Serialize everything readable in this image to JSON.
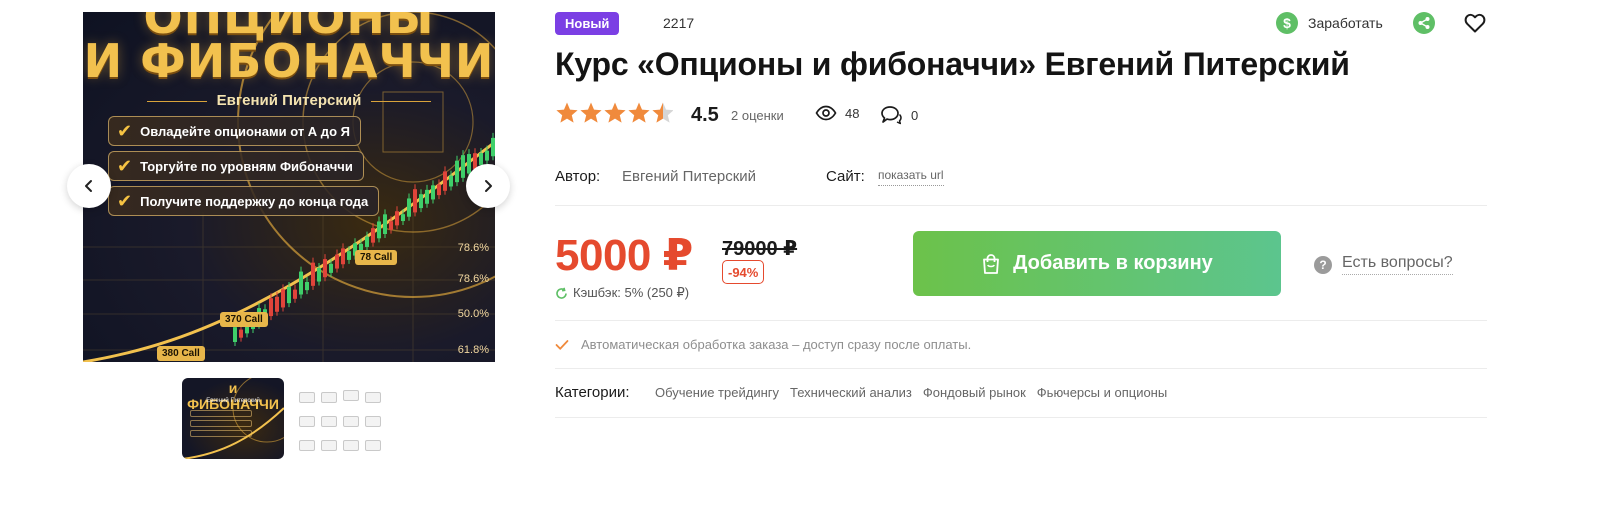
{
  "gallery": {
    "image_title_line1": "ОПЦИОНЫ",
    "image_title_line2": "И ФИБОНАЧЧИ",
    "image_author": "Евгений Питерский",
    "image_bullets": [
      "Овладейте опционами от А до Я",
      "Торгуйте по уровням Фибоначчи",
      "Получите поддержку до конца года"
    ],
    "fib_levels": [
      "78.6%",
      "78.6%",
      "50.0%",
      "61.8%"
    ],
    "call_labels": [
      "78 Call",
      "370 Call",
      "380 Call"
    ],
    "thumb_title": "и ФИБОНАЧЧИ",
    "thumb_author": "Евгений Питерский",
    "prev_icon": "chevron-left-icon",
    "next_icon": "chevron-right-icon"
  },
  "header": {
    "badge": "Новый",
    "sku": "2217",
    "earn_label": "Заработать",
    "earn_icon": "dollar-coin-icon",
    "share_icon": "share-icon",
    "favorite_icon": "heart-icon"
  },
  "product": {
    "title": "Курс «Опционы и фибоначчи» Евгений Питерский",
    "rating": 4.5,
    "rating_text": "4.5",
    "rating_count": "2 оценки",
    "views": "48",
    "comments": "0",
    "author_label": "Автор:",
    "author": "Евгений Питерский",
    "site_label": "Сайт:",
    "site_link": "показать url"
  },
  "pricing": {
    "price": "5000 ₽",
    "old_price": "79000 ₽",
    "discount": "-94%",
    "cashback": "Кэшбэк: 5% (250 ₽)",
    "cart_button": "Добавить в корзину",
    "questions": "Есть вопросы?"
  },
  "notes": {
    "auto": "Автоматическая обработка заказа – доступ сразу после оплаты."
  },
  "categories": {
    "label": "Категории:",
    "items": [
      "Обучение трейдингу",
      "Технический анализ",
      "Фондовый рынок",
      "Фьючерсы и опционы"
    ]
  },
  "colors": {
    "accent_price": "#e54a2e",
    "badge_new": "#7b3fe4",
    "cart_button": "#6cc24a",
    "stars": "#f08a3c"
  }
}
